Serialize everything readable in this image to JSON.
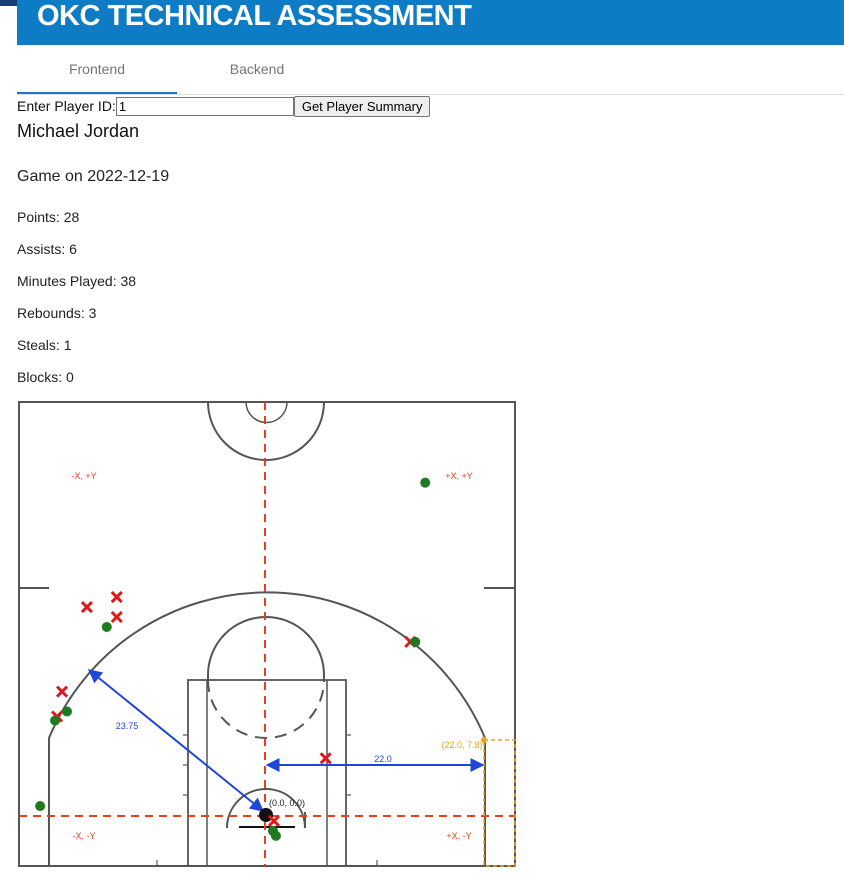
{
  "header": {
    "title": "OKC TECHNICAL ASSESSMENT"
  },
  "tabs": [
    {
      "label": "Frontend",
      "active": true
    },
    {
      "label": "Backend",
      "active": false
    }
  ],
  "search": {
    "label": "Enter Player ID:",
    "value": "1",
    "button_label": "Get Player Summary"
  },
  "player": {
    "name": "Michael Jordan"
  },
  "game": {
    "title": "Game on 2022-12-19"
  },
  "stats": [
    {
      "label": "Points",
      "value": "28",
      "text": "Points: 28"
    },
    {
      "label": "Assists",
      "value": "6",
      "text": "Assists: 6"
    },
    {
      "label": "Minutes Played",
      "value": "38",
      "text": "Minutes Played: 38"
    },
    {
      "label": "Rebounds",
      "value": "3",
      "text": "Rebounds: 3"
    },
    {
      "label": "Steals",
      "value": "1",
      "text": "Steals: 1"
    },
    {
      "label": "Blocks",
      "value": "0",
      "text": "Blocks: 0"
    }
  ],
  "court": {
    "quadrants": {
      "top_left": "-X, +Y",
      "top_right": "+X, +Y",
      "bottom_left": "-X, -Y",
      "bottom_right": "+X, -Y"
    },
    "origin_label": "(0.0, 0.0)",
    "corner_label": "(22.0, 7.8)",
    "three_point_radius_label": "23.75",
    "corner_distance_label": "22.0",
    "shots": [
      {
        "x": 16.0,
        "y": 33.5,
        "made": true
      },
      {
        "x": -18.0,
        "y": 21.0,
        "made": false
      },
      {
        "x": -15.0,
        "y": 22.0,
        "made": false
      },
      {
        "x": -15.0,
        "y": 20.0,
        "made": false
      },
      {
        "x": -16.0,
        "y": 19.0,
        "made": true
      },
      {
        "x": 14.5,
        "y": 17.5,
        "made": false
      },
      {
        "x": 15.0,
        "y": 17.5,
        "made": true
      },
      {
        "x": -20.5,
        "y": 12.5,
        "made": false
      },
      {
        "x": -21.0,
        "y": 10.0,
        "made": false
      },
      {
        "x": -20.0,
        "y": 10.5,
        "made": true
      },
      {
        "x": -21.2,
        "y": 9.6,
        "made": true
      },
      {
        "x": 6.0,
        "y": 5.8,
        "made": false
      },
      {
        "x": -22.7,
        "y": 1.0,
        "made": true
      },
      {
        "x": 0.8,
        "y": -0.5,
        "made": false
      },
      {
        "x": 0.7,
        "y": -1.5,
        "made": true
      },
      {
        "x": 1.0,
        "y": -2.0,
        "made": true
      }
    ],
    "colors": {
      "made": "#1e7a1e",
      "missed": "#e01818",
      "axis": "#e8401c",
      "annotation": "#1f47d6",
      "corner": "#f0a020",
      "lines": "#555555"
    }
  }
}
